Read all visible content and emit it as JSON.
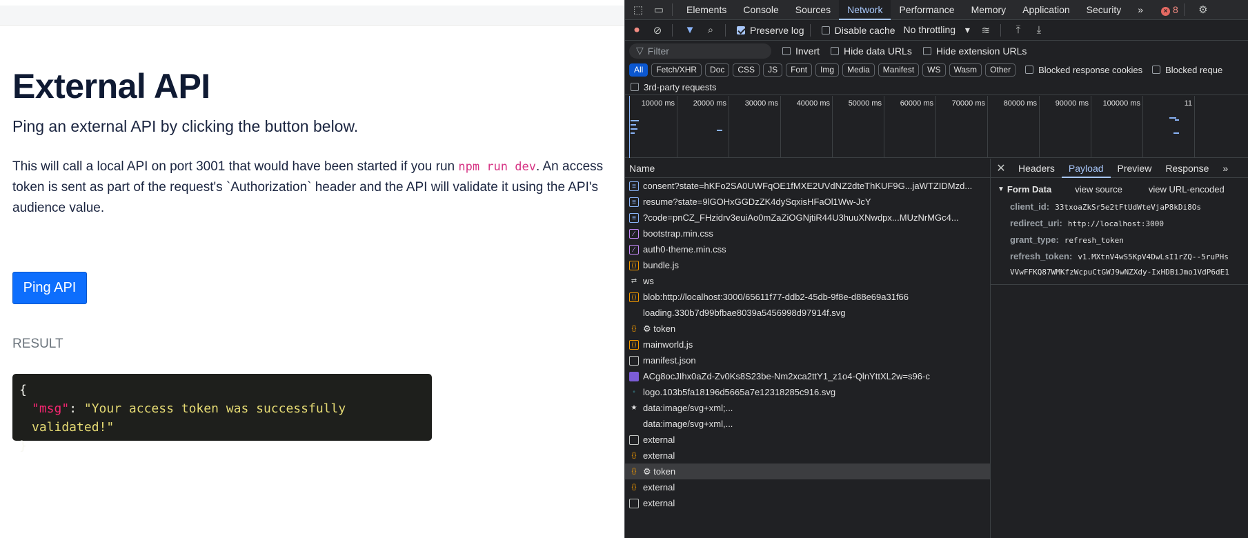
{
  "app": {
    "title": "External API",
    "lead": "Ping an external API by clicking the button below.",
    "para_before": "This will call a local API on port 3001 that would have been started if you run ",
    "para_code": "npm run dev",
    "para_after": ". An access token is sent as part of the request's `Authorization` header and the API will validate it using the API's audience value.",
    "ping_button": "Ping API",
    "result_label": "RESULT",
    "result": {
      "open": "{",
      "key": "\"msg\"",
      "colon": ": ",
      "value": "\"Your access token was successfully validated!\"",
      "close": "}"
    }
  },
  "devtools": {
    "tabs": [
      "Elements",
      "Console",
      "Sources",
      "Network",
      "Performance",
      "Memory",
      "Application",
      "Security"
    ],
    "active_tab": "Network",
    "more": "»",
    "error_count": "8",
    "toolbar": {
      "preserve_log": "Preserve log",
      "disable_cache": "Disable cache",
      "throttling": "No throttling"
    },
    "filter": {
      "placeholder": "Filter",
      "invert": "Invert",
      "hide_data_urls": "Hide data URLs",
      "hide_extension_urls": "Hide extension URLs"
    },
    "types": [
      "All",
      "Fetch/XHR",
      "Doc",
      "CSS",
      "JS",
      "Font",
      "Img",
      "Media",
      "Manifest",
      "WS",
      "Wasm",
      "Other"
    ],
    "blocked_cookies": "Blocked response cookies",
    "blocked_requests": "Blocked reque",
    "third_party": "3rd-party requests",
    "timeline_ticks": [
      "10000 ms",
      "20000 ms",
      "30000 ms",
      "40000 ms",
      "50000 ms",
      "60000 ms",
      "70000 ms",
      "80000 ms",
      "90000 ms",
      "100000 ms",
      "11"
    ],
    "name_header": "Name",
    "requests": [
      {
        "name": "consent?state=hKFo2SA0UWFqOE1fMXE2UVdNZ2dteThKUF9G...jaWTZIDMzd...",
        "icon": "doc"
      },
      {
        "name": "resume?state=9lGOHxGGDzZK4dySqxisHFaOl1Ww-JcY",
        "icon": "doc"
      },
      {
        "name": "?code=pnCZ_FHzidrv3euiAo0mZaZiOGNjtiR44U3huuXNwdpx...MUzNrMGc4...",
        "icon": "doc"
      },
      {
        "name": "bootstrap.min.css",
        "icon": "css"
      },
      {
        "name": "auth0-theme.min.css",
        "icon": "css"
      },
      {
        "name": "bundle.js",
        "icon": "js"
      },
      {
        "name": "ws",
        "icon": "ws"
      },
      {
        "name": "blob:http://localhost:3000/65611f77-ddb2-45db-9f8e-d88e69a31f66",
        "icon": "js"
      },
      {
        "name": "loading.330b7d99bfbae8039a5456998d97914f.svg",
        "icon": "blank"
      },
      {
        "name": "⚙ token",
        "icon": "xhr"
      },
      {
        "name": "mainworld.js",
        "icon": "js"
      },
      {
        "name": "manifest.json",
        "icon": "file"
      },
      {
        "name": "ACg8ocJIhx0aZd-Zv0Ks8S23be-Nm2xca2ttY1_z1o4-QlnYttXL2w=s96-c",
        "icon": "img"
      },
      {
        "name": "logo.103b5fa18196d5665a7e12318285c916.svg",
        "icon": "svg"
      },
      {
        "name": "data:image/svg+xml;...",
        "icon": "star"
      },
      {
        "name": "data:image/svg+xml,...",
        "icon": "blank"
      },
      {
        "name": "external",
        "icon": "file"
      },
      {
        "name": "external",
        "icon": "xhr"
      },
      {
        "name": "⚙ token",
        "icon": "xhr"
      },
      {
        "name": "external",
        "icon": "xhr"
      },
      {
        "name": "external",
        "icon": "file"
      }
    ],
    "selected_request": 18,
    "detail": {
      "tabs": [
        "Headers",
        "Payload",
        "Preview",
        "Response"
      ],
      "active_tab": "Payload",
      "more": "»",
      "section_title": "Form Data",
      "view_source": "view source",
      "view_url_encoded": "view URL-encoded",
      "fields": [
        {
          "key": "client_id:",
          "value": "33txoaZkSr5e2tFtUdWteVjaP8kDi8Os"
        },
        {
          "key": "redirect_uri:",
          "value": "http://localhost:3000"
        },
        {
          "key": "grant_type:",
          "value": "refresh_token"
        },
        {
          "key": "refresh_token:",
          "value": "v1.MXtnV4wS5KpV4DwLsI1rZQ--5ruPHs"
        }
      ],
      "refresh_token_cont": "VVwFFKQ87WMKfzWcpuCtGWJ9wNZXdy-IxHDBiJmo1VdP6dE1"
    }
  }
}
